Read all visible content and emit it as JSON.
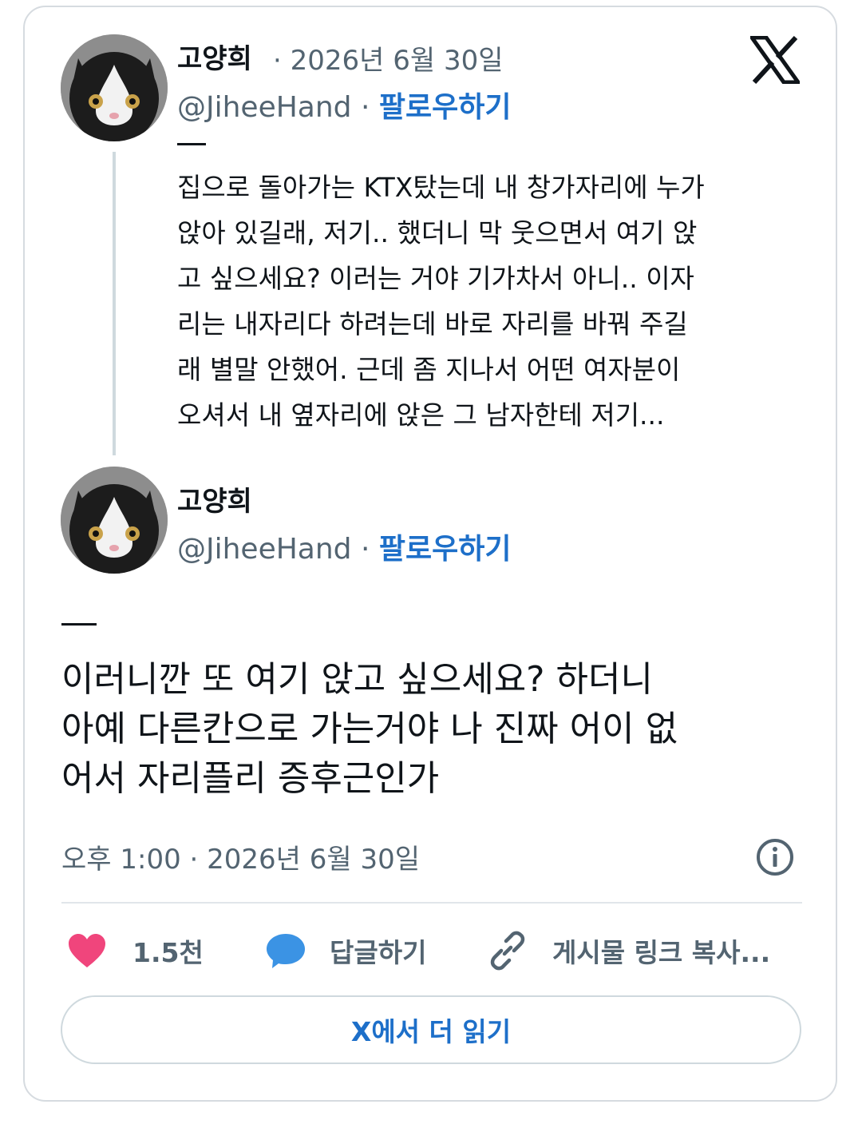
{
  "tweet1": {
    "author_name": "고양희",
    "date": "· 2026년 6월 30일",
    "handle": "@JiheeHand",
    "separator": " · ",
    "follow_label": "팔로우하기",
    "body_lines": [
      "집으로 돌아가는 KTX탔는데 내 창가자리에 누가",
      "앉아 있길래, 저기.. 했더니 막 웃으면서 여기 앉",
      "고 싶으세요? 이러는 거야 기가차서 아니.. 이자",
      "리는 내자리다 하려는데 바로 자리를 바꿔 주길",
      "래 별말 안했어. 근데 좀 지나서 어떤 여자분이",
      "오셔서 내 옆자리에 앉은 그 남자한테 저기..."
    ]
  },
  "tweet2": {
    "author_name": "고양희",
    "handle": "@JiheeHand",
    "separator": " · ",
    "follow_label": "팔로우하기",
    "body_lines": [
      "이러니깐 또  여기 앉고 싶으세요? 하더니",
      "아예 다른칸으로 가는거야 나 진짜 어이 없",
      "어서 자리플리 증후근인가"
    ],
    "timestamp": "오후 1:00 · 2026년 6월 30일"
  },
  "actions": {
    "like_count": "1.5천",
    "reply_label": "답글하기",
    "copy_link_label": "게시물 링크 복사..."
  },
  "read_more_label": "X에서 더 읽기",
  "icons": {
    "brand": "x-logo-icon",
    "info": "info-icon",
    "like": "heart-icon",
    "reply": "speech-bubble-icon",
    "link": "link-icon"
  },
  "colors": {
    "follow": "#1d6fc9",
    "heart": "#f0457c",
    "reply_bubble": "#3b93e4",
    "secondary_text": "#536471"
  }
}
